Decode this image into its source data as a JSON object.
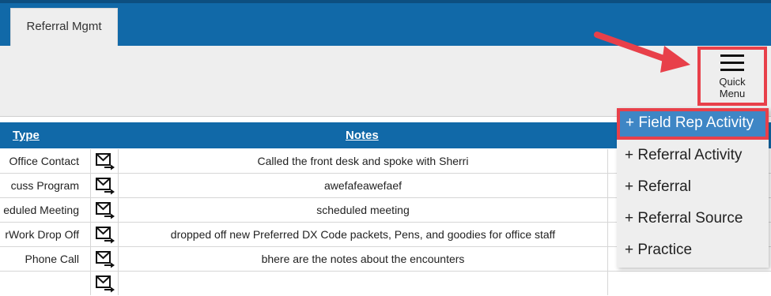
{
  "header": {
    "tab_label": "Referral Mgmt"
  },
  "quick_menu": {
    "label_line1": "Quick",
    "label_line2": "Menu"
  },
  "table": {
    "headers": {
      "type": "Type",
      "notes": "Notes"
    },
    "rows": [
      {
        "type": "Office Contact",
        "icon": "mail-forward-icon",
        "notes": "Called the front desk and spoke with Sherri"
      },
      {
        "type": "cuss Program",
        "icon": "mail-forward-icon",
        "notes": "awefafeawefaef"
      },
      {
        "type": "eduled Meeting",
        "icon": "mail-forward-icon",
        "notes": "scheduled meeting"
      },
      {
        "type": "rWork Drop Off",
        "icon": "mail-forward-icon",
        "notes": "dropped off new Preferred DX Code packets, Pens, and goodies for office staff"
      },
      {
        "type": "Phone Call",
        "icon": "mail-forward-icon",
        "notes": "bhere are the notes about the encounters"
      }
    ]
  },
  "dropdown": {
    "items": [
      "+ Field Rep Activity",
      "+ Referral Activity",
      "+ Referral",
      "+ Referral Source",
      "+ Practice"
    ]
  },
  "colors": {
    "header_blue": "#1169a8",
    "highlight_red": "#e8404a",
    "active_item_blue": "#3e86c5"
  }
}
